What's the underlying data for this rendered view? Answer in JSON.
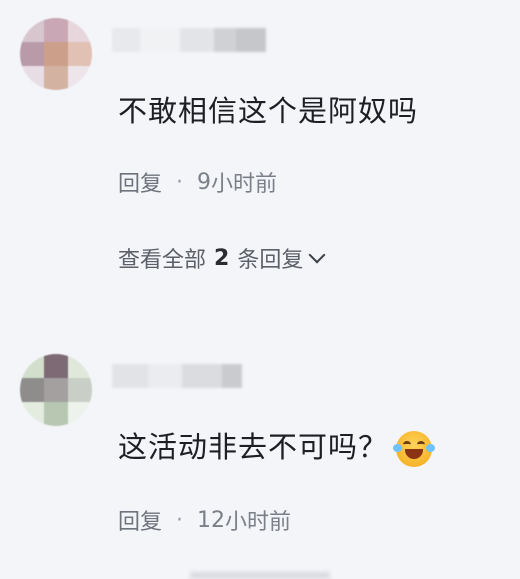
{
  "comments": [
    {
      "text": "不敢相信这个是阿奴吗",
      "reply_label": "回复",
      "separator": "·",
      "time_number": "9",
      "time_unit": "小时前",
      "view_all_prefix": "查看全部",
      "view_all_count": "2",
      "view_all_suffix": "条回复",
      "avatar_colors": [
        "#d8c6cf",
        "#c9a7b4",
        "#e7d7dc",
        "#b99aa8",
        "#cc9f8b",
        "#e1c1b3",
        "#e7dde4",
        "#d4b2a2",
        "#eee5ea"
      ]
    },
    {
      "text": "这活动非去不可吗？",
      "reply_label": "回复",
      "separator": "·",
      "time_number": "12",
      "time_unit": "小时前",
      "avatar_colors": [
        "#d3dfcd",
        "#7e6a74",
        "#dfe8da",
        "#8f8d8c",
        "#a4a0a0",
        "#c9cfc6",
        "#e4ece0",
        "#b7c7b2",
        "#eef2ec"
      ]
    }
  ],
  "emoji_name": "laughing-tears-emoji"
}
